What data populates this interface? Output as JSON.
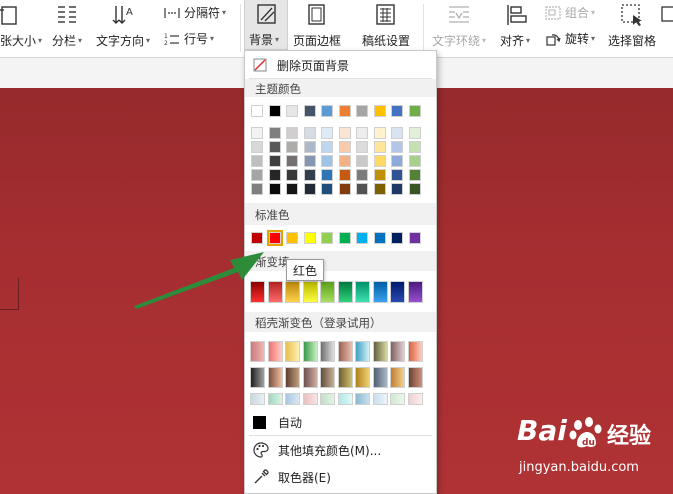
{
  "ribbon": {
    "paper_size": "纸张大小",
    "columns": "分栏",
    "text_direction": "文字方向",
    "separator": "分隔符",
    "line_number": "行号",
    "background": "背景",
    "page_border": "页面边框",
    "manuscript": "稿纸设置",
    "text_wrap": "文字环绕",
    "align": "对齐",
    "group": "组合",
    "rotate": "旋转",
    "selection_pane": "选择窗格"
  },
  "menu": {
    "remove_bg": "删除页面背景",
    "theme_colors": "主题颜色",
    "standard_colors": "标准色",
    "gradient_fill": "渐变填",
    "docer_gradient": "稻壳渐变色（登录试用）",
    "auto": "自动",
    "more_fill": "其他填充颜色(M)...",
    "eyedropper": "取色器(E)"
  },
  "tooltip": "红色",
  "colors": {
    "theme_top": [
      "#ffffff",
      "#000000",
      "#e7e6e6",
      "#44546a",
      "#5b9bd5",
      "#ed7d31",
      "#a5a5a5",
      "#ffc000",
      "#4472c4",
      "#70ad47"
    ],
    "theme_shades": [
      [
        "#f2f2f2",
        "#7f7f7f",
        "#d0cece",
        "#d6dce4",
        "#deebf6",
        "#fbe5d5",
        "#ededed",
        "#fff2cc",
        "#dae3f3",
        "#e2efd9"
      ],
      [
        "#d8d8d8",
        "#595959",
        "#aeabab",
        "#adb9ca",
        "#bdd7ee",
        "#f7cbac",
        "#dbdbdb",
        "#fee599",
        "#b4c6e7",
        "#c5e0b3"
      ],
      [
        "#bfbfbf",
        "#3f3f3f",
        "#757070",
        "#8496b0",
        "#9dc3e6",
        "#f4b183",
        "#c9c9c9",
        "#ffd965",
        "#8eaadb",
        "#a8d08d"
      ],
      [
        "#a5a5a5",
        "#262626",
        "#3a3838",
        "#323f4f",
        "#2e75b5",
        "#c55a11",
        "#7b7b7b",
        "#bf9000",
        "#2f5496",
        "#538135"
      ],
      [
        "#7f7f7f",
        "#0c0c0c",
        "#171616",
        "#222a35",
        "#1e4e79",
        "#833c0b",
        "#525252",
        "#7f6000",
        "#1f3864",
        "#375623"
      ]
    ],
    "standard": [
      "#c00000",
      "#ff0000",
      "#ffc000",
      "#ffff00",
      "#92d050",
      "#00b050",
      "#00b0f0",
      "#0070c0",
      "#002060",
      "#7030a0"
    ],
    "gradient": [
      [
        "#8b0000",
        "#ff3030"
      ],
      [
        "#b22222",
        "#ff6a6a"
      ],
      [
        "#b8860b",
        "#ffd34d"
      ],
      [
        "#b5b500",
        "#ffff40"
      ],
      [
        "#5a9e1a",
        "#a8e060"
      ],
      [
        "#007a3d",
        "#2ed37e"
      ],
      [
        "#00906a",
        "#40e0b0"
      ],
      [
        "#005fa3",
        "#3aa0f0"
      ],
      [
        "#001a6e",
        "#2a4ab0"
      ],
      [
        "#4b1a80",
        "#9a4fd0"
      ]
    ],
    "docer": [
      [
        [
          "#c97b7b",
          "#f0b8b0"
        ],
        [
          "#f07070",
          "#fcd0c8"
        ],
        [
          "#e8c050",
          "#fff0b0"
        ],
        [
          "#3a9a4a",
          "#c8f0c0"
        ],
        [
          "#707070",
          "#e0e0e0"
        ],
        [
          "#a06050",
          "#e8c0b0"
        ],
        [
          "#40a0c0",
          "#d0f0f8"
        ],
        [
          "#606040",
          "#d8d8a0"
        ],
        [
          "#806060",
          "#e0d0d0"
        ],
        [
          "#e06040",
          "#fcd0c0"
        ]
      ],
      [
        [
          "#202020",
          "#a0a0a0"
        ],
        [
          "#805040",
          "#f0c0a0"
        ],
        [
          "#604030",
          "#c0a080"
        ],
        [
          "#705050",
          "#d0b0a0"
        ],
        [
          "#605040",
          "#c8b090"
        ],
        [
          "#706030",
          "#d0c070"
        ],
        [
          "#b08020",
          "#f0d070"
        ],
        [
          "#506070",
          "#a8b8c8"
        ],
        [
          "#c08030",
          "#f0d090"
        ],
        [
          "#704030",
          "#d09080"
        ]
      ],
      [
        [
          "#c8d8e0",
          "#e8f0f4"
        ],
        [
          "#a0d8c0",
          "#d8f4e8"
        ],
        [
          "#a8c8e0",
          "#dce8f4"
        ],
        [
          "#e8c0c0",
          "#f8e4e4"
        ],
        [
          "#c0e0c8",
          "#e4f4e8"
        ],
        [
          "#b0e8e8",
          "#e0f8f8"
        ],
        [
          "#8ab8d0",
          "#c8e0ee"
        ],
        [
          "#c8e0f0",
          "#ecf4fa"
        ],
        [
          "#d0e8d0",
          "#eef8ee"
        ],
        [
          "#f0d0d0",
          "#fceeee"
        ]
      ]
    ],
    "auto": "#000000",
    "arrow": "#2e8b3a",
    "document_bg": "#a92c30"
  },
  "watermark": {
    "brand": "Bai",
    "suffix": "经验",
    "url": "jingyan.baidu.com"
  }
}
